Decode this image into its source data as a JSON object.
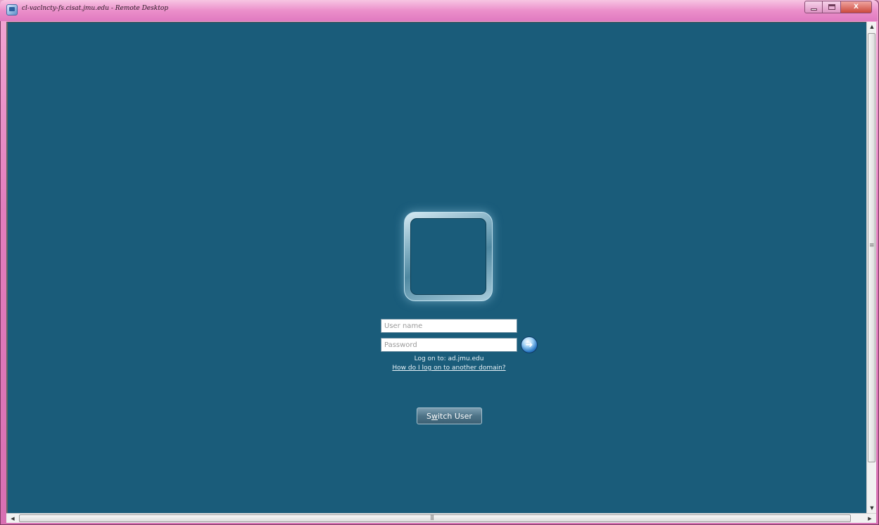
{
  "window": {
    "title": "cl-vaclncty-fs.cisat.jmu.edu - Remote Desktop",
    "controls": {
      "minimize": "minimize",
      "maximize": "maximize",
      "close": "X"
    }
  },
  "login": {
    "username_placeholder": "User name",
    "password_placeholder": "Password",
    "logon_to": "Log on to: ad.jmu.edu",
    "domain_help_link": "How do I log on to another domain?",
    "switch_user_label_a": "S",
    "switch_user_label_b": "w",
    "switch_user_label_c": "itch User"
  },
  "icons": {
    "window": "remote-desktop-icon",
    "submit": "arrow-right-icon"
  },
  "colors": {
    "desktop_bg": "#1a5c7a",
    "frame_accent": "#e27dbd"
  }
}
